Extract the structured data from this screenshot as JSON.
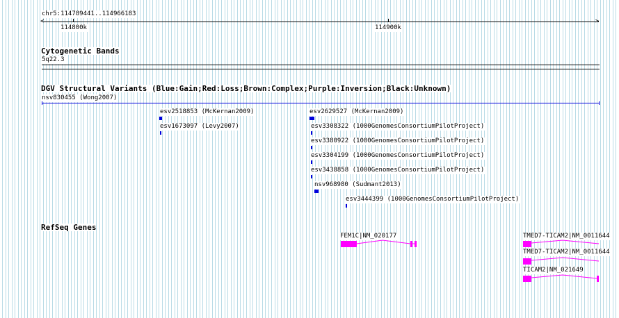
{
  "ruler": {
    "region": "chr5:114789441..114966183",
    "tick_labels": [
      "114800k",
      "114900k"
    ]
  },
  "cytoband": {
    "title": "Cytogenetic Bands",
    "band": "5q22.3"
  },
  "dgv": {
    "title": "DGV Structural Variants (Blue:Gain;Red:Loss;Brown:Complex;Purple:Inversion;Black:Unknown)",
    "top_feature": "nsv830455 (Wong2007)",
    "features": [
      {
        "id": "esv2518853",
        "source": "McKernan2009",
        "label": "esv2518853 (McKernan2009)",
        "color": "#0000dd"
      },
      {
        "id": "esv1673097",
        "source": "Levy2007",
        "label": "esv1673097 (Levy2007)",
        "color": "#0000dd"
      },
      {
        "id": "esv2629527",
        "source": "McKernan2009",
        "label": "esv2629527 (McKernan2009)",
        "color": "#0000dd"
      },
      {
        "id": "esv3308322",
        "source": "1000GenomesConsortiumPilotProject",
        "label": "esv3308322 (1000GenomesConsortiumPilotProject)",
        "color": "#0000dd"
      },
      {
        "id": "esv3380922",
        "source": "1000GenomesConsortiumPilotProject",
        "label": "esv3380922 (1000GenomesConsortiumPilotProject)",
        "color": "#0000dd"
      },
      {
        "id": "esv3304199",
        "source": "1000GenomesConsortiumPilotProject",
        "label": "esv3304199 (1000GenomesConsortiumPilotProject)",
        "color": "#0000dd"
      },
      {
        "id": "esv3438858",
        "source": "1000GenomesConsortiumPilotProject",
        "label": "esv3438858 (1000GenomesConsortiumPilotProject)",
        "color": "#0000dd"
      },
      {
        "id": "nsv968980",
        "source": "Sudmant2013",
        "label": "nsv968980 (Sudmant2013)",
        "color": "#0000dd"
      },
      {
        "id": "esv3444399",
        "source": "1000GenomesConsortiumPilotProject",
        "label": "esv3444399 (1000GenomesConsortiumPilotProject)",
        "color": "#0000dd"
      }
    ]
  },
  "refseq": {
    "title": "RefSeq Genes",
    "genes": [
      {
        "label": "FEM1C|NM_020177",
        "color": "#ff00ff"
      },
      {
        "label": "TMED7-TICAM2|NM_0011644",
        "color": "#ff00ff"
      },
      {
        "label": "TMED7-TICAM2|NM_0011644",
        "color": "#ff00ff"
      },
      {
        "label": "TICAM2|NM_021649",
        "color": "#ff00ff"
      }
    ]
  },
  "colors": {
    "grid_line": "#b9dbe6",
    "gain": "#0000dd",
    "gene": "#ff00ff"
  }
}
